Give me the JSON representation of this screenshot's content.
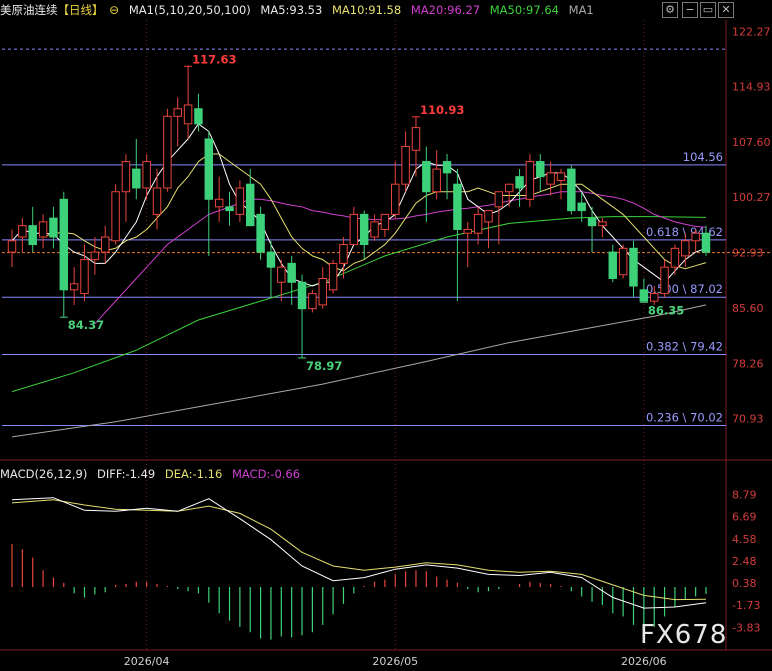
{
  "header": {
    "instrument": "美原油连续",
    "period": "【日线】",
    "ma_group": "MA1(5,10,20,50,100)",
    "ma5": "MA5:93.53",
    "ma10": "MA10:91.58",
    "ma20": "MA20:96.27",
    "ma50": "MA50:97.64",
    "ma1": "MA1"
  },
  "macd_header": {
    "name": "MACD(26,12,9)",
    "diff": "DIFF:-1.49",
    "dea": "DEA:-1.16",
    "macd": "MACD:-0.66"
  },
  "watermark": "FX678",
  "colors": {
    "up": "#e8453c",
    "down": "#3dd17a",
    "ma5": "#ffffff",
    "ma10": "#e6e070",
    "ma20": "#d040d0",
    "ma50": "#3cd23c",
    "ma100": "#a8a8a8",
    "fib": "#8a8aff",
    "grid": "#7a1e1e",
    "axis_text": "#d23c3c"
  },
  "chart_data": [
    {
      "type": "candlestick",
      "panel": "price",
      "ylim": [
        66.5,
        123.5
      ],
      "y_ticks": [
        "122.27",
        "114.93",
        "107.60",
        "100.27",
        "92.93",
        "85.60",
        "78.26",
        "70.93"
      ],
      "x_ticks": [
        "2026/04",
        "2026/05",
        "2026/06"
      ],
      "x_tick_index": [
        13,
        37,
        61
      ],
      "candles": [
        [
          93,
          96,
          91,
          94.5
        ],
        [
          95,
          97.5,
          93,
          96.5
        ],
        [
          96.5,
          99,
          93,
          94
        ],
        [
          95,
          98,
          93.5,
          97
        ],
        [
          97.5,
          99,
          93.5,
          95
        ],
        [
          100,
          101,
          84.4,
          88
        ],
        [
          88,
          91,
          86,
          88.8
        ],
        [
          87.5,
          94,
          86.5,
          92
        ],
        [
          92,
          95,
          90,
          93
        ],
        [
          93,
          96.5,
          91.5,
          95
        ],
        [
          94.5,
          102,
          94,
          101
        ],
        [
          101,
          106,
          97,
          105
        ],
        [
          104,
          108,
          100,
          101.5
        ],
        [
          101.5,
          106,
          100,
          105
        ],
        [
          98,
          104,
          96,
          101.5
        ],
        [
          101.5,
          112,
          101,
          111
        ],
        [
          111,
          113.5,
          107,
          112
        ],
        [
          110,
          117.6,
          108,
          112.5
        ],
        [
          112,
          114,
          109,
          110
        ],
        [
          108,
          109,
          92.5,
          100
        ],
        [
          99,
          103,
          97,
          100
        ],
        [
          99,
          101,
          96.5,
          98.5
        ],
        [
          98,
          102.5,
          97,
          101.5
        ],
        [
          102,
          104,
          97,
          96.5
        ],
        [
          98,
          99,
          92,
          93
        ],
        [
          93,
          94.5,
          87,
          91
        ],
        [
          89,
          92,
          86.5,
          91
        ],
        [
          91.5,
          92.5,
          86,
          89
        ],
        [
          89,
          90,
          79,
          85.5
        ],
        [
          85.5,
          88,
          85,
          87.5
        ],
        [
          86,
          91,
          85.5,
          89.5
        ],
        [
          88,
          92,
          87.5,
          91.5
        ],
        [
          91.5,
          95,
          89.5,
          94
        ],
        [
          94,
          99,
          94,
          98
        ],
        [
          98,
          98.5,
          92,
          94
        ],
        [
          95,
          98,
          94.5,
          97
        ],
        [
          96,
          97.5,
          95,
          98
        ],
        [
          98,
          105,
          97.5,
          102
        ],
        [
          102,
          109,
          101,
          107
        ],
        [
          106.5,
          110.9,
          103,
          109.5
        ],
        [
          105,
          107,
          97,
          101
        ],
        [
          101,
          106.5,
          100,
          104
        ],
        [
          105,
          106,
          100,
          103.5
        ],
        [
          102,
          104,
          86.5,
          96
        ],
        [
          95.5,
          97,
          91,
          96
        ],
        [
          95.5,
          99,
          94,
          98
        ],
        [
          97,
          98,
          93.5,
          98.5
        ],
        [
          99,
          101,
          94,
          101
        ],
        [
          101,
          102,
          99,
          102
        ],
        [
          103,
          104,
          99,
          101.5
        ],
        [
          100,
          106,
          99,
          105
        ],
        [
          105,
          106,
          101,
          103
        ],
        [
          102,
          105,
          100.5,
          103.5
        ],
        [
          102.5,
          104,
          100,
          103.5
        ],
        [
          104,
          104.5,
          98,
          98.5
        ],
        [
          99.5,
          101,
          97,
          98.5
        ],
        [
          97.5,
          99,
          93,
          96.5
        ],
        [
          96.5,
          97.5,
          95,
          97
        ],
        [
          93,
          94,
          89,
          89.5
        ],
        [
          90,
          94,
          89.5,
          93.5
        ],
        [
          93.5,
          94.5,
          87,
          88.5
        ],
        [
          88,
          89.5,
          86.35,
          86.5
        ],
        [
          86.5,
          88.5,
          86,
          87.5
        ],
        [
          87.5,
          92,
          87,
          91
        ],
        [
          91,
          94,
          90,
          93.5
        ],
        [
          92.5,
          95.5,
          91,
          94.5
        ],
        [
          94.5,
          96,
          93,
          95.5
        ],
        [
          95.5,
          96.5,
          92.5,
          93
        ]
      ],
      "ma5": [
        94.5,
        96,
        95.5,
        95.5,
        95.4,
        94,
        93,
        92.5,
        91.5,
        91.5,
        93,
        95,
        97,
        100.5,
        103,
        105,
        106.5,
        108,
        110,
        109,
        106,
        102,
        99.5,
        98.5,
        97,
        94,
        91.5,
        89.5,
        89,
        88.5,
        89,
        89,
        91,
        94,
        95,
        96.5,
        97,
        98,
        101,
        104,
        105,
        104.5,
        104.5,
        103.5,
        100,
        99,
        98,
        98.5,
        99.5,
        101,
        102.5,
        103,
        103.5,
        103.5,
        102.5,
        101,
        98.5,
        96.5,
        95,
        93.5,
        92,
        91,
        90,
        89,
        90.5,
        92,
        93,
        93.5
      ],
      "ma10": [
        null,
        null,
        null,
        95,
        95.5,
        95.6,
        95.4,
        94.5,
        93.7,
        93.2,
        93.5,
        94.5,
        95,
        96,
        97.5,
        99,
        101.5,
        103,
        105,
        106,
        106,
        105,
        104,
        103,
        102,
        100,
        97.5,
        95,
        93.5,
        92.5,
        92,
        91,
        90.5,
        91.5,
        92,
        93,
        94,
        95.5,
        97.5,
        99.5,
        100.5,
        101,
        101,
        101,
        101,
        101.5,
        101,
        100.5,
        100.5,
        100.5,
        100.5,
        101,
        101.5,
        102,
        102,
        102,
        101,
        100,
        99,
        98,
        96.5,
        95,
        93.5,
        92,
        91.2,
        90.8,
        91.2,
        91.6
      ],
      "ma20": [
        null,
        null,
        null,
        null,
        null,
        null,
        null,
        null,
        83.5,
        85,
        86.5,
        88,
        89.5,
        91,
        92.5,
        94,
        95,
        96,
        97,
        98,
        98.5,
        99,
        99.5,
        100,
        100,
        99.8,
        99.5,
        99.2,
        99,
        98.5,
        98.3,
        98,
        97.8,
        97.5,
        97.4,
        97.3,
        97.3,
        97.4,
        97.5,
        97.8,
        98,
        98.3,
        98.5,
        98.7,
        98.8,
        99,
        99.2,
        99.5,
        99.8,
        100,
        100.3,
        100.5,
        100.7,
        101,
        101,
        101,
        100.8,
        100.5,
        100.3,
        100,
        99.5,
        98.8,
        98,
        97.5,
        97,
        96.7,
        96.4,
        96.3
      ],
      "ma50": [
        null,
        null,
        null,
        null,
        null,
        null,
        null,
        null,
        null,
        null,
        null,
        null,
        null,
        null,
        null,
        null,
        null,
        null,
        null,
        null,
        null,
        null,
        null,
        null,
        null,
        null,
        null,
        null,
        null,
        null,
        null,
        null,
        null,
        null,
        null,
        null,
        null,
        null,
        null,
        null,
        null,
        null,
        null,
        null,
        null,
        null,
        null,
        null,
        null,
        null,
        null,
        null,
        null,
        null,
        null,
        null,
        null,
        null,
        null,
        null,
        null,
        null,
        null,
        null,
        null,
        null,
        null,
        null
      ],
      "ma50_points": [
        [
          0,
          74.5
        ],
        [
          6,
          77
        ],
        [
          12,
          80
        ],
        [
          18,
          84
        ],
        [
          24,
          86.5
        ],
        [
          30,
          89
        ],
        [
          36,
          92.5
        ],
        [
          42,
          95
        ],
        [
          48,
          96.8
        ],
        [
          54,
          97.5
        ],
        [
          58,
          97.7
        ],
        [
          62,
          97.7
        ],
        [
          67,
          97.6
        ]
      ],
      "ma100_points": [
        [
          0,
          68.5
        ],
        [
          10,
          70.5
        ],
        [
          20,
          73
        ],
        [
          30,
          75.5
        ],
        [
          40,
          78.5
        ],
        [
          48,
          81
        ],
        [
          56,
          83
        ],
        [
          62,
          84.5
        ],
        [
          67,
          86
        ]
      ],
      "fib_levels": [
        {
          "value": 119.9,
          "label": ""
        },
        {
          "value": 104.56,
          "label": "104.56"
        },
        {
          "value": 94.62,
          "label": "0.618 \\ 94.62"
        },
        {
          "value": 87.02,
          "label": "0.500 \\ 87.02"
        },
        {
          "value": 79.42,
          "label": "0.382 \\ 79.42"
        },
        {
          "value": 70.02,
          "label": "0.236 \\ 70.02"
        }
      ],
      "current_price": 92.93,
      "annotations": [
        {
          "index": 17,
          "value": 117.63,
          "text": "117.63",
          "color": "up",
          "pos": "above"
        },
        {
          "index": 39,
          "value": 110.93,
          "text": "110.93",
          "color": "up",
          "pos": "above"
        },
        {
          "index": 5,
          "value": 84.37,
          "text": "84.37",
          "color": "down",
          "pos": "below"
        },
        {
          "index": 28,
          "value": 78.97,
          "text": "78.97",
          "color": "down",
          "pos": "below"
        },
        {
          "index": 61,
          "value": 86.35,
          "text": "86.35",
          "color": "down",
          "pos": "below"
        }
      ]
    },
    {
      "type": "bar+line",
      "panel": "macd",
      "ylim": [
        -5.8,
        9.8
      ],
      "y_ticks": [
        "8.79",
        "6.69",
        "4.58",
        "2.48",
        "0.38",
        "-1.73",
        "-3.83"
      ],
      "diff_points": [
        [
          0,
          8.3
        ],
        [
          4,
          8.5
        ],
        [
          7,
          7.3
        ],
        [
          10,
          7.2
        ],
        [
          13,
          7.5
        ],
        [
          16,
          7.2
        ],
        [
          19,
          8.4
        ],
        [
          22,
          6.5
        ],
        [
          25,
          4.5
        ],
        [
          28,
          2.0
        ],
        [
          31,
          0.6
        ],
        [
          34,
          0.9
        ],
        [
          37,
          1.7
        ],
        [
          40,
          2.1
        ],
        [
          43,
          1.8
        ],
        [
          46,
          1.2
        ],
        [
          49,
          1.1
        ],
        [
          52,
          1.4
        ],
        [
          55,
          0.9
        ],
        [
          58,
          -1.0
        ],
        [
          61,
          -2.0
        ],
        [
          64,
          -1.9
        ],
        [
          67,
          -1.5
        ]
      ],
      "dea_points": [
        [
          0,
          8.0
        ],
        [
          4,
          8.3
        ],
        [
          7,
          7.8
        ],
        [
          10,
          7.4
        ],
        [
          13,
          7.3
        ],
        [
          16,
          7.2
        ],
        [
          19,
          7.7
        ],
        [
          22,
          7.0
        ],
        [
          25,
          5.5
        ],
        [
          28,
          3.3
        ],
        [
          31,
          2.0
        ],
        [
          34,
          1.6
        ],
        [
          37,
          1.9
        ],
        [
          40,
          2.3
        ],
        [
          43,
          2.1
        ],
        [
          46,
          1.6
        ],
        [
          49,
          1.4
        ],
        [
          52,
          1.5
        ],
        [
          55,
          1.2
        ],
        [
          58,
          0.2
        ],
        [
          61,
          -0.8
        ],
        [
          64,
          -1.2
        ],
        [
          67,
          -1.16
        ]
      ],
      "macd": [
        4.1,
        3.6,
        2.8,
        1.6,
        0.9,
        0.4,
        -0.6,
        -1.0,
        -0.7,
        -0.5,
        0.2,
        0.3,
        0.5,
        0.5,
        0.3,
        0.1,
        -0.2,
        -0.4,
        -0.6,
        -1.5,
        -2.5,
        -3.2,
        -3.8,
        -4.3,
        -4.9,
        -5.0,
        -4.7,
        -4.8,
        -4.6,
        -4.3,
        -3.6,
        -2.6,
        -1.6,
        -0.6,
        0.1,
        0.5,
        0.7,
        1.2,
        1.5,
        1.6,
        1.5,
        1.0,
        0.7,
        0.4,
        -0.2,
        -0.5,
        -0.4,
        -0.2,
        0.0,
        0.3,
        0.5,
        0.4,
        0.3,
        0.1,
        -0.4,
        -0.9,
        -1.4,
        -1.7,
        -2.5,
        -2.8,
        -3.6,
        -4.2,
        -3.8,
        -2.8,
        -1.9,
        -1.2,
        -0.9,
        -0.66
      ]
    }
  ]
}
